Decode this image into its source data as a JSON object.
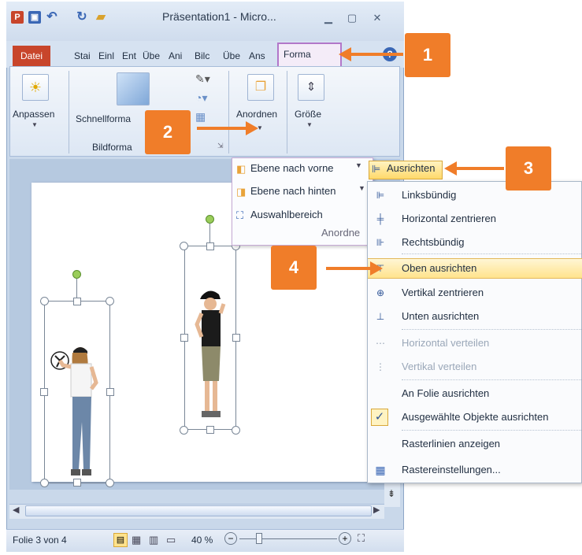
{
  "window": {
    "title": "Präsentation1 - Micro...",
    "tabs": [
      "Datei",
      "Stai",
      "Einl",
      "Ent",
      "Übe",
      "Ani",
      "Bilc",
      "Übe",
      "Ans",
      "Forma"
    ]
  },
  "ribbon": {
    "adjust_label": "Anpassen",
    "quickstyles_label": "Schnellforma",
    "arrange_label": "Anordnen",
    "size_label": "Größe",
    "group_picture_styles": "Bildforma"
  },
  "arrange_menu": {
    "items": [
      "Ebene nach vorne",
      "Ebene nach hinten",
      "Auswahlbereich"
    ],
    "group_label": "Anordne"
  },
  "align_button": "Ausrichten",
  "align_menu": {
    "items": [
      {
        "label": "Linksbündig",
        "enabled": true
      },
      {
        "label": "Horizontal zentrieren",
        "enabled": true
      },
      {
        "label": "Rechtsbündig",
        "enabled": true
      },
      {
        "label": "Oben ausrichten",
        "enabled": true,
        "highlighted": true
      },
      {
        "label": "Vertikal zentrieren",
        "enabled": true
      },
      {
        "label": "Unten ausrichten",
        "enabled": true
      },
      {
        "label": "Horizontal verteilen",
        "enabled": false
      },
      {
        "label": "Vertikal verteilen",
        "enabled": false
      },
      {
        "label": "An Folie ausrichten",
        "enabled": true
      },
      {
        "label": "Ausgewählte Objekte ausrichten",
        "enabled": true,
        "checked": true
      },
      {
        "label": "Rasterlinien anzeigen",
        "enabled": true
      },
      {
        "label": "Rastereinstellungen...",
        "enabled": true
      }
    ]
  },
  "callouts": [
    "1",
    "2",
    "3",
    "4"
  ],
  "status": {
    "slide": "Folie 3 von 4",
    "zoom": "40 %"
  },
  "colors": {
    "accent_orange": "#f07d29",
    "file_tab_red": "#c8452b",
    "active_tab_purple": "#b277c9",
    "highlight": "#ffe38c"
  }
}
